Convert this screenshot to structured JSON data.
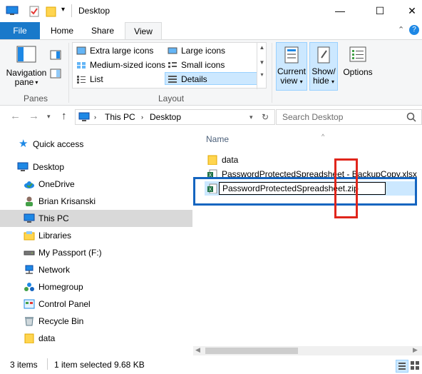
{
  "window": {
    "title": "Desktop",
    "minimize_glyph": "—",
    "maximize_glyph": "☐",
    "close_glyph": "✕"
  },
  "ribbon_tabs": {
    "file": "File",
    "home": "Home",
    "share": "Share",
    "view": "View"
  },
  "ribbon": {
    "panes_group": "Panes",
    "navigation_pane": "Navigation",
    "navigation_pane_line2": "pane",
    "layout_group": "Layout",
    "layout_options": [
      "Extra large icons",
      "Large icons",
      "Medium-sized icons",
      "Small icons",
      "List",
      "Details"
    ],
    "current_view": "Current",
    "current_view_line2": "view",
    "show_hide": "Show/",
    "show_hide_line2": "hide",
    "options": "Options"
  },
  "address": {
    "crumb1": "This PC",
    "crumb2": "Desktop",
    "search_placeholder": "Search Desktop"
  },
  "nav_pane": {
    "items": [
      "Quick access",
      "Desktop",
      "OneDrive",
      "Brian Krisanski",
      "This PC",
      "Libraries",
      "My Passport (F:)",
      "Network",
      "Homegroup",
      "Control Panel",
      "Recycle Bin",
      "data"
    ]
  },
  "content": {
    "column_name": "Name",
    "files": [
      "data",
      "PasswordProtectedSpreadsheet - BackupCopy.xlsx"
    ],
    "rename_value": "PasswordProtectedSpreadsheet.zip"
  },
  "status": {
    "items_count": "3 items",
    "selected": "1 item selected",
    "size": "9.68 KB"
  },
  "colors": {
    "accent": "#1979ca",
    "selection": "#cce8ff",
    "annotation_blue": "#1565c0",
    "annotation_red": "#e0261c"
  }
}
